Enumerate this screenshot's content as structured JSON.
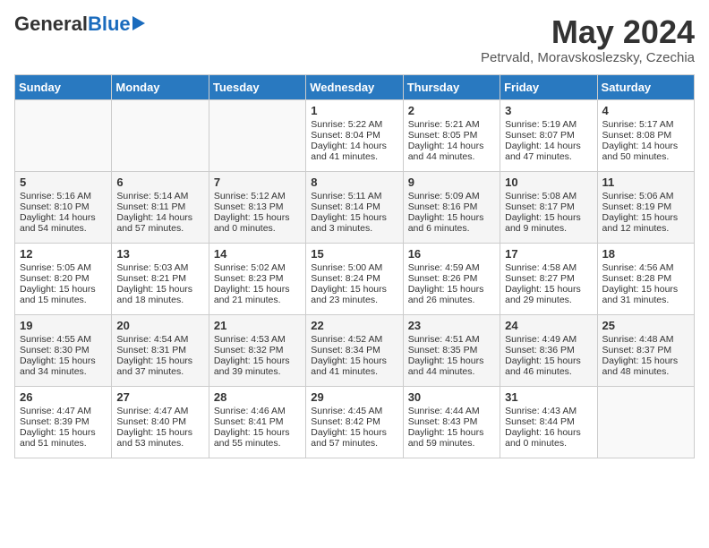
{
  "header": {
    "logo_general": "General",
    "logo_blue": "Blue",
    "month": "May 2024",
    "location": "Petrvald, Moravskoslezsky, Czechia"
  },
  "days_of_week": [
    "Sunday",
    "Monday",
    "Tuesday",
    "Wednesday",
    "Thursday",
    "Friday",
    "Saturday"
  ],
  "weeks": [
    [
      {
        "day": "",
        "info": ""
      },
      {
        "day": "",
        "info": ""
      },
      {
        "day": "",
        "info": ""
      },
      {
        "day": "1",
        "info": "Sunrise: 5:22 AM\nSunset: 8:04 PM\nDaylight: 14 hours and 41 minutes."
      },
      {
        "day": "2",
        "info": "Sunrise: 5:21 AM\nSunset: 8:05 PM\nDaylight: 14 hours and 44 minutes."
      },
      {
        "day": "3",
        "info": "Sunrise: 5:19 AM\nSunset: 8:07 PM\nDaylight: 14 hours and 47 minutes."
      },
      {
        "day": "4",
        "info": "Sunrise: 5:17 AM\nSunset: 8:08 PM\nDaylight: 14 hours and 50 minutes."
      }
    ],
    [
      {
        "day": "5",
        "info": "Sunrise: 5:16 AM\nSunset: 8:10 PM\nDaylight: 14 hours and 54 minutes."
      },
      {
        "day": "6",
        "info": "Sunrise: 5:14 AM\nSunset: 8:11 PM\nDaylight: 14 hours and 57 minutes."
      },
      {
        "day": "7",
        "info": "Sunrise: 5:12 AM\nSunset: 8:13 PM\nDaylight: 15 hours and 0 minutes."
      },
      {
        "day": "8",
        "info": "Sunrise: 5:11 AM\nSunset: 8:14 PM\nDaylight: 15 hours and 3 minutes."
      },
      {
        "day": "9",
        "info": "Sunrise: 5:09 AM\nSunset: 8:16 PM\nDaylight: 15 hours and 6 minutes."
      },
      {
        "day": "10",
        "info": "Sunrise: 5:08 AM\nSunset: 8:17 PM\nDaylight: 15 hours and 9 minutes."
      },
      {
        "day": "11",
        "info": "Sunrise: 5:06 AM\nSunset: 8:19 PM\nDaylight: 15 hours and 12 minutes."
      }
    ],
    [
      {
        "day": "12",
        "info": "Sunrise: 5:05 AM\nSunset: 8:20 PM\nDaylight: 15 hours and 15 minutes."
      },
      {
        "day": "13",
        "info": "Sunrise: 5:03 AM\nSunset: 8:21 PM\nDaylight: 15 hours and 18 minutes."
      },
      {
        "day": "14",
        "info": "Sunrise: 5:02 AM\nSunset: 8:23 PM\nDaylight: 15 hours and 21 minutes."
      },
      {
        "day": "15",
        "info": "Sunrise: 5:00 AM\nSunset: 8:24 PM\nDaylight: 15 hours and 23 minutes."
      },
      {
        "day": "16",
        "info": "Sunrise: 4:59 AM\nSunset: 8:26 PM\nDaylight: 15 hours and 26 minutes."
      },
      {
        "day": "17",
        "info": "Sunrise: 4:58 AM\nSunset: 8:27 PM\nDaylight: 15 hours and 29 minutes."
      },
      {
        "day": "18",
        "info": "Sunrise: 4:56 AM\nSunset: 8:28 PM\nDaylight: 15 hours and 31 minutes."
      }
    ],
    [
      {
        "day": "19",
        "info": "Sunrise: 4:55 AM\nSunset: 8:30 PM\nDaylight: 15 hours and 34 minutes."
      },
      {
        "day": "20",
        "info": "Sunrise: 4:54 AM\nSunset: 8:31 PM\nDaylight: 15 hours and 37 minutes."
      },
      {
        "day": "21",
        "info": "Sunrise: 4:53 AM\nSunset: 8:32 PM\nDaylight: 15 hours and 39 minutes."
      },
      {
        "day": "22",
        "info": "Sunrise: 4:52 AM\nSunset: 8:34 PM\nDaylight: 15 hours and 41 minutes."
      },
      {
        "day": "23",
        "info": "Sunrise: 4:51 AM\nSunset: 8:35 PM\nDaylight: 15 hours and 44 minutes."
      },
      {
        "day": "24",
        "info": "Sunrise: 4:49 AM\nSunset: 8:36 PM\nDaylight: 15 hours and 46 minutes."
      },
      {
        "day": "25",
        "info": "Sunrise: 4:48 AM\nSunset: 8:37 PM\nDaylight: 15 hours and 48 minutes."
      }
    ],
    [
      {
        "day": "26",
        "info": "Sunrise: 4:47 AM\nSunset: 8:39 PM\nDaylight: 15 hours and 51 minutes."
      },
      {
        "day": "27",
        "info": "Sunrise: 4:47 AM\nSunset: 8:40 PM\nDaylight: 15 hours and 53 minutes."
      },
      {
        "day": "28",
        "info": "Sunrise: 4:46 AM\nSunset: 8:41 PM\nDaylight: 15 hours and 55 minutes."
      },
      {
        "day": "29",
        "info": "Sunrise: 4:45 AM\nSunset: 8:42 PM\nDaylight: 15 hours and 57 minutes."
      },
      {
        "day": "30",
        "info": "Sunrise: 4:44 AM\nSunset: 8:43 PM\nDaylight: 15 hours and 59 minutes."
      },
      {
        "day": "31",
        "info": "Sunrise: 4:43 AM\nSunset: 8:44 PM\nDaylight: 16 hours and 0 minutes."
      },
      {
        "day": "",
        "info": ""
      }
    ]
  ]
}
